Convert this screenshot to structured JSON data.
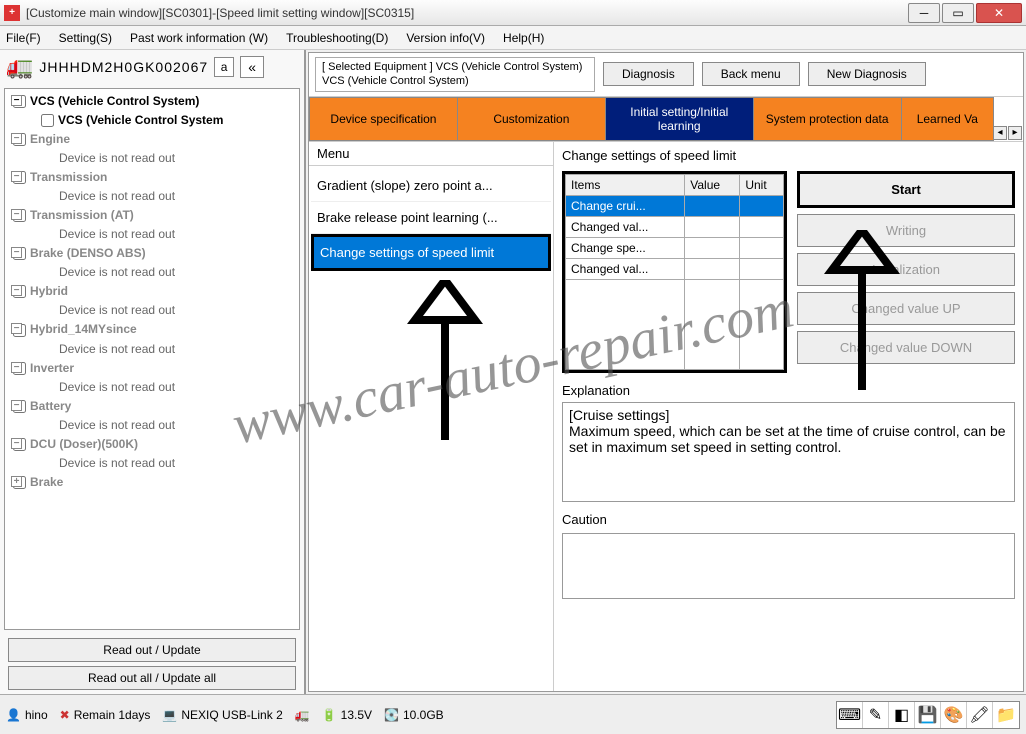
{
  "window": {
    "title": "[Customize main window][SC0301]-[Speed limit setting window][SC0315]",
    "icon": "+"
  },
  "menubar": [
    "File(F)",
    "Setting(S)",
    "Past work information (W)",
    "Troubleshooting(D)",
    "Version info(V)",
    "Help(H)"
  ],
  "vehicle": {
    "vin": "JHHHDM2H0GK002067",
    "a_btn": "a",
    "collapse": "«"
  },
  "tree": [
    {
      "t": "root",
      "label": "VCS (Vehicle Control System)",
      "toggle": "−"
    },
    {
      "t": "child",
      "label": "VCS (Vehicle Control System"
    },
    {
      "t": "root",
      "label": "Engine",
      "toggle": "−",
      "gray": true
    },
    {
      "t": "sub",
      "label": "Device is not read out"
    },
    {
      "t": "root",
      "label": "Transmission",
      "toggle": "−",
      "gray": true
    },
    {
      "t": "sub",
      "label": "Device is not read out"
    },
    {
      "t": "root",
      "label": "Transmission (AT)",
      "toggle": "−",
      "gray": true
    },
    {
      "t": "sub",
      "label": "Device is not read out"
    },
    {
      "t": "root",
      "label": "Brake (DENSO ABS)",
      "toggle": "−",
      "gray": true
    },
    {
      "t": "sub",
      "label": "Device is not read out"
    },
    {
      "t": "root",
      "label": "Hybrid",
      "toggle": "−",
      "gray": true
    },
    {
      "t": "sub",
      "label": "Device is not read out"
    },
    {
      "t": "root",
      "label": "Hybrid_14MYsince",
      "toggle": "−",
      "gray": true
    },
    {
      "t": "sub",
      "label": "Device is not read out"
    },
    {
      "t": "root",
      "label": "Inverter",
      "toggle": "−",
      "gray": true
    },
    {
      "t": "sub",
      "label": "Device is not read out"
    },
    {
      "t": "root",
      "label": "Battery",
      "toggle": "−",
      "gray": true
    },
    {
      "t": "sub",
      "label": "Device is not read out"
    },
    {
      "t": "root",
      "label": "DCU (Doser)(500K)",
      "toggle": "−",
      "gray": true
    },
    {
      "t": "sub",
      "label": "Device is not read out"
    },
    {
      "t": "root",
      "label": "Brake",
      "toggle": "+",
      "gray": true
    }
  ],
  "side_buttons": {
    "read": "Read out / Update",
    "read_all": "Read out all / Update all"
  },
  "main_header": {
    "equip": "[ Selected Equipment ] VCS (Vehicle Control System) VCS (Vehicle Control System)",
    "diagnosis": "Diagnosis",
    "back": "Back menu",
    "new": "New Diagnosis"
  },
  "tabs": [
    "Device specification",
    "Customization",
    "Initial setting/Initial learning",
    "System protection data",
    "Learned Va"
  ],
  "menu_pane": {
    "title": "Menu",
    "items": [
      "Gradient (slope) zero point a...",
      "Brake release point learning (...",
      "Change settings of speed limit"
    ]
  },
  "detail": {
    "title": "Change settings of speed limit",
    "cols": [
      "Items",
      "Value",
      "Unit"
    ],
    "rows": [
      "Change crui...",
      "Changed val...",
      "Change spe...",
      "Changed val..."
    ],
    "actions": {
      "start": "Start",
      "writing": "Writing",
      "init": "Initialization",
      "up": "Changed value UP",
      "down": "Changed value DOWN"
    },
    "expl_label": "Explanation",
    "expl_text": "[Cruise settings]\nMaximum speed, which can be set at the time of cruise control, can be set in maximum set speed in setting control.",
    "caution_label": "Caution"
  },
  "status": {
    "user": "hino",
    "remain": "Remain 1days",
    "interface": "NEXIQ USB-Link 2",
    "volt": "13.5V",
    "disk": "10.0GB"
  },
  "watermark": "www.car-auto-repair.com"
}
